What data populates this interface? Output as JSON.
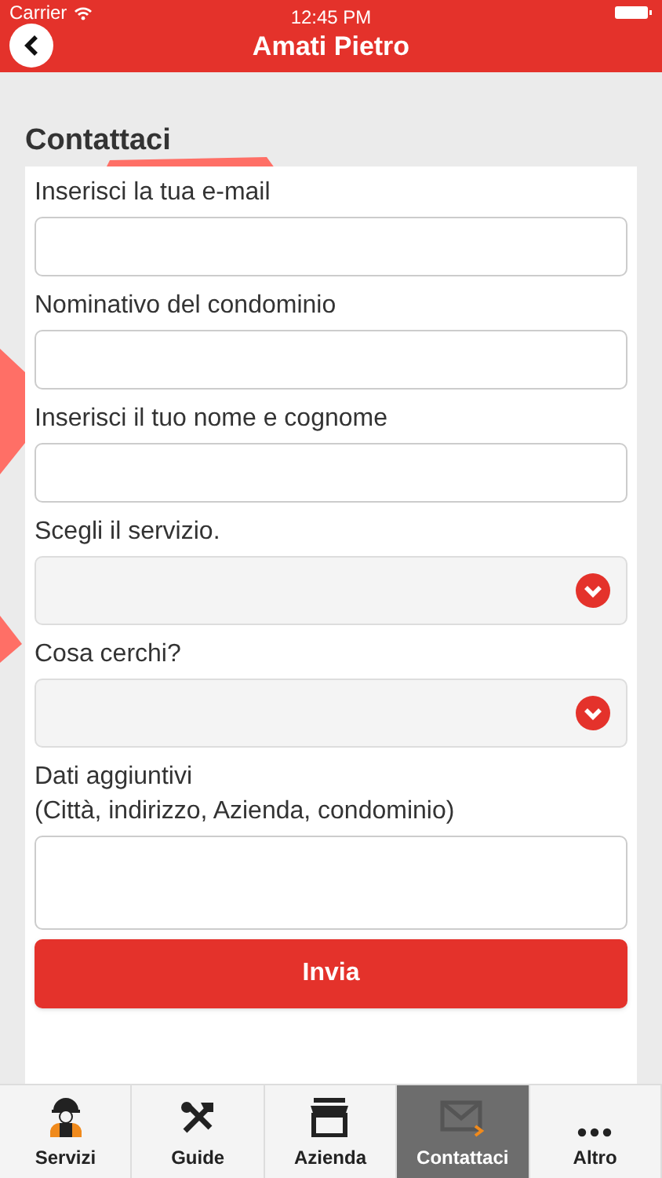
{
  "status_bar": {
    "carrier": "Carrier",
    "time": "12:45 PM"
  },
  "header": {
    "title": "Amati Pietro"
  },
  "section_title": "Contattaci",
  "fields": [
    {
      "kind": "text",
      "label": "Inserisci la tua e-mail"
    },
    {
      "kind": "text",
      "label": "Nominativo del condominio"
    },
    {
      "kind": "text",
      "label": "Inserisci il tuo nome e cognome"
    },
    {
      "kind": "select",
      "label": "Scegli il servizio."
    },
    {
      "kind": "select",
      "label": "Cosa cerchi?"
    },
    {
      "kind": "textarea",
      "label": "Dati aggiuntivi\n(Città, indirizzo, Azienda, condominio)"
    }
  ],
  "submit": "Invia",
  "tabs": [
    {
      "kind": "worker",
      "label": "Servizi",
      "selected": false
    },
    {
      "kind": "tools",
      "label": "Guide",
      "selected": false
    },
    {
      "kind": "store",
      "label": "Azienda",
      "selected": false
    },
    {
      "kind": "mail",
      "label": "Contattaci",
      "selected": true
    },
    {
      "kind": "more",
      "label": "Altro",
      "selected": false
    }
  ]
}
